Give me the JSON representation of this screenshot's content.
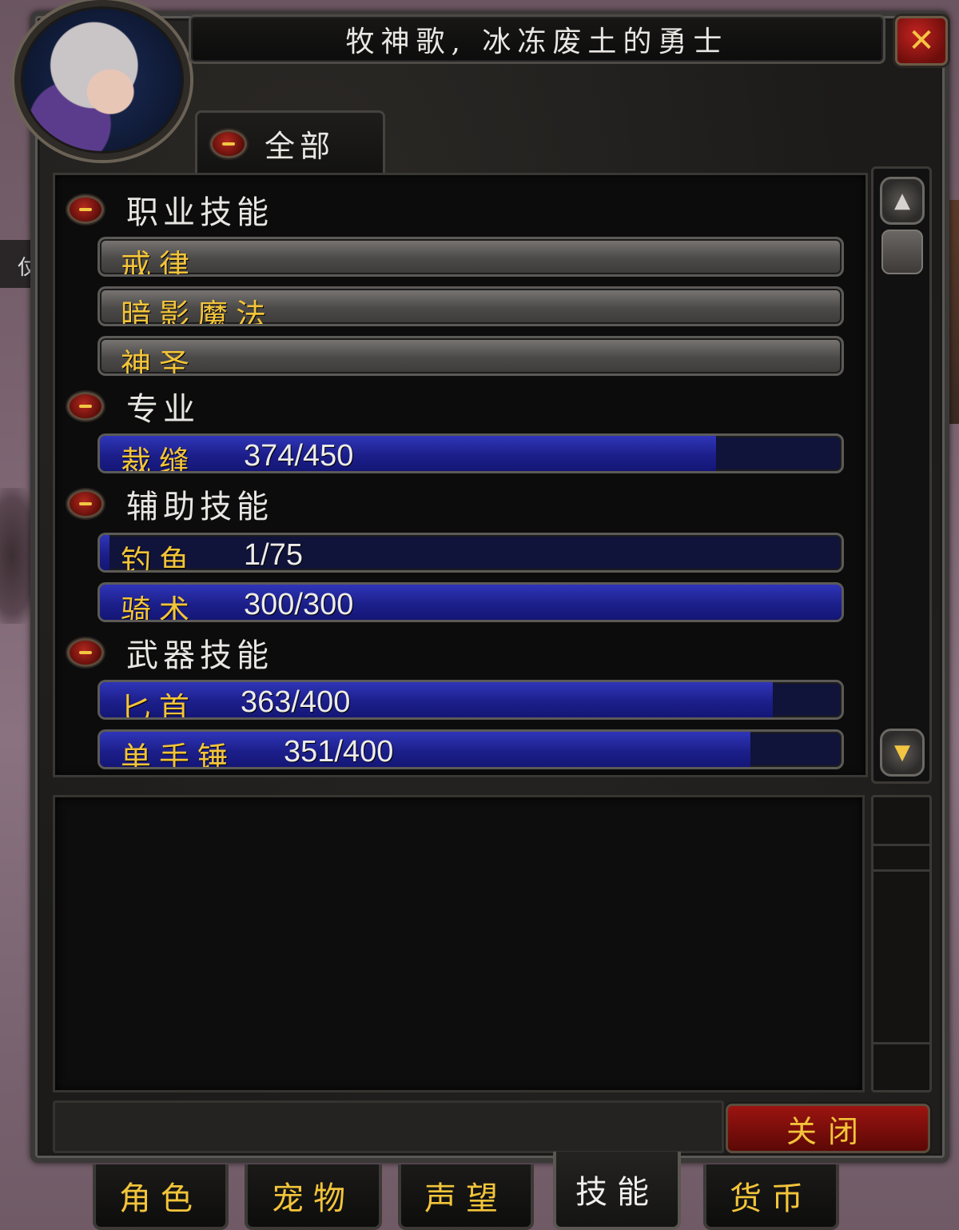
{
  "window": {
    "title": "牧神歌, 冰冻废土的勇士",
    "close_icon": "✕",
    "portrait_name": "portrait"
  },
  "filter_tab": {
    "label": "全部"
  },
  "categories": [
    {
      "label": "职业技能"
    },
    {
      "label": "专业"
    },
    {
      "label": "辅助技能"
    },
    {
      "label": "武器技能"
    }
  ],
  "skills": [
    {
      "name": "戒律",
      "rank": "",
      "progress": null,
      "category": "职业技能"
    },
    {
      "name": "暗影魔法",
      "rank": "",
      "progress": null,
      "category": "职业技能"
    },
    {
      "name": "神圣",
      "rank": "",
      "progress": null,
      "category": "职业技能"
    },
    {
      "name": "裁缝",
      "rank": "374/450",
      "progress": 0.831,
      "category": "专业"
    },
    {
      "name": "钓鱼",
      "rank": "1/75",
      "progress": 0.013,
      "category": "辅助技能"
    },
    {
      "name": "骑术",
      "rank": "300/300",
      "progress": 1.0,
      "category": "辅助技能"
    },
    {
      "name": "匕首",
      "rank": "363/400",
      "progress": 0.9075,
      "category": "武器技能"
    },
    {
      "name": "单手锤",
      "rank": "351/400",
      "progress": 0.8775,
      "category": "武器技能"
    }
  ],
  "buttons": {
    "close_label": "关闭"
  },
  "bottom_tabs": [
    {
      "label": "角色",
      "active": false
    },
    {
      "label": "宠物",
      "active": false
    },
    {
      "label": "声望",
      "active": false
    },
    {
      "label": "技能",
      "active": true
    },
    {
      "label": "货币",
      "active": false
    }
  ],
  "colors": {
    "skill_name": "#f2c43a",
    "rank_text": "#ecebe8",
    "bar_fill": "#1c1f8a",
    "bar_bg": "#10133a",
    "close_button": "#9b1410"
  }
}
